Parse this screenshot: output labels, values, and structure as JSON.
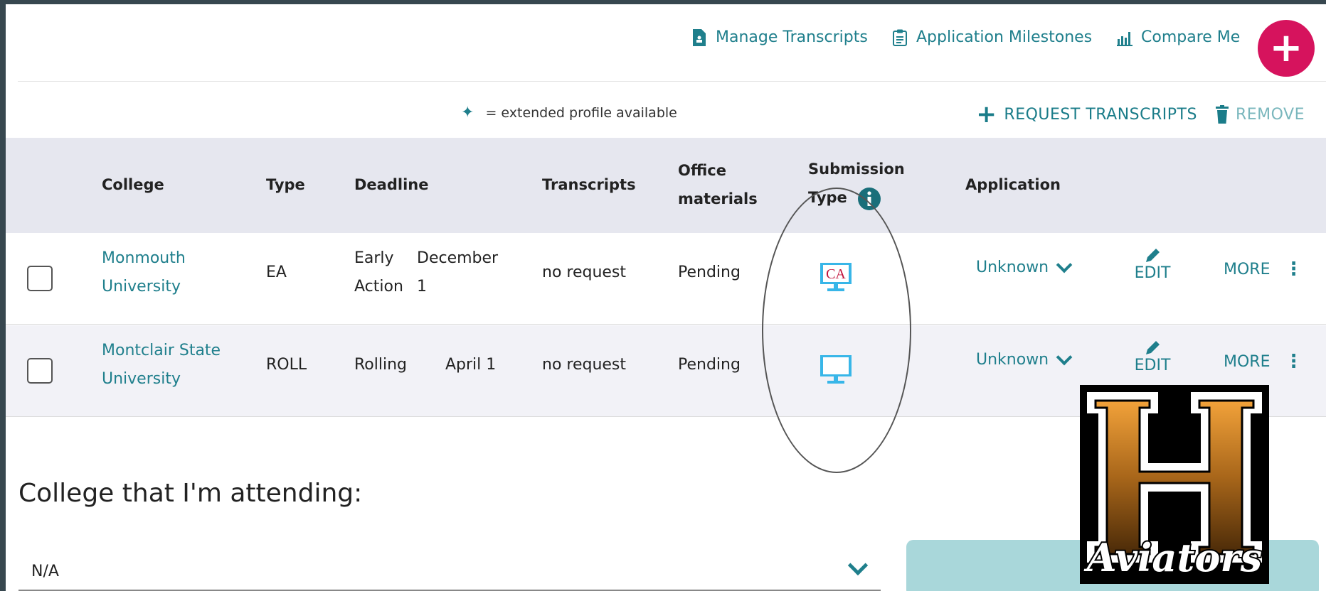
{
  "toplinks": {
    "manage_transcripts": "Manage Transcripts",
    "application_milestones": "Application Milestones",
    "compare_me": "Compare Me",
    "fab_label": "+"
  },
  "legend": {
    "symbol": "✦",
    "text": "= extended profile available"
  },
  "actions": {
    "request_icon": "+",
    "request_label": "REQUEST TRANSCRIPTS",
    "remove_label": "REMOVE"
  },
  "table": {
    "headers": {
      "college": "College",
      "type": "Type",
      "deadline": "Deadline",
      "transcripts": "Transcripts",
      "office_line1": "Office",
      "office_line2": "materials",
      "submission_line1": "Submission",
      "submission_line2": "Type",
      "application": "Application"
    },
    "rows": [
      {
        "college_line1": "Monmouth",
        "college_line2": "University",
        "type": "EA",
        "deadline_type_line1": "Early",
        "deadline_type_line2": "Action",
        "deadline_date_line1": "December",
        "deadline_date_line2": "1",
        "transcripts": "no request",
        "office_materials": "Pending",
        "submission_icon": "common-app-monitor-icon",
        "submission_text": "CA",
        "application": "Unknown",
        "edit": "EDIT",
        "more": "MORE"
      },
      {
        "college_line1": "Montclair State",
        "college_line2": "University",
        "type": "ROLL",
        "deadline_type": "Rolling",
        "deadline_date": "April 1",
        "transcripts": "no request",
        "office_materials": "Pending",
        "submission_icon": "monitor-icon",
        "application": "Unknown",
        "edit": "EDIT",
        "more": "MORE"
      }
    ]
  },
  "attending": {
    "title": "College that I'm attending:",
    "value": "N/A"
  },
  "logo": {
    "letter": "H",
    "script_text": "Aviators"
  },
  "colors": {
    "teal": "#1f7f8c",
    "fab": "#d6135d",
    "header_bg": "#e6e7ef",
    "button": "#a9d7da"
  }
}
